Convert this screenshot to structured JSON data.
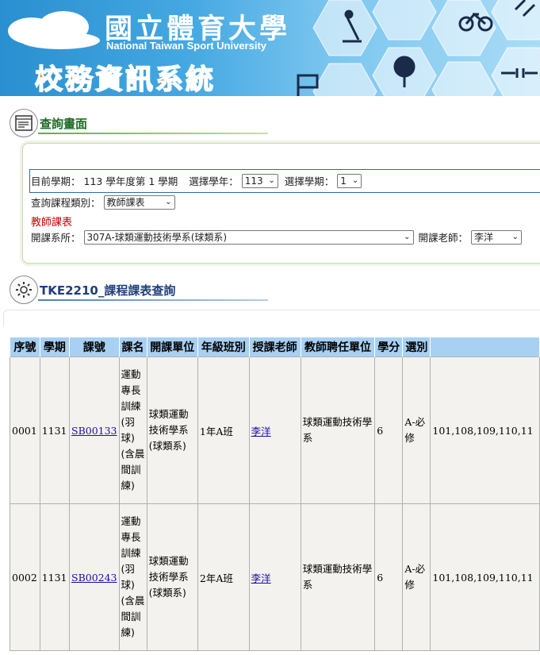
{
  "banner": {
    "title_cn": "國立體育大學",
    "title_en": "National Taiwan Sport University",
    "subtitle": "校務資訊系統"
  },
  "query_section": {
    "title": "查詢畫面",
    "term_label": "目前學期：",
    "term_value": "113 學年度第 1 學期",
    "year_label": "選擇學年：",
    "year_value": "113",
    "semester_label": "選擇學期：",
    "semester_value": "1",
    "category_label": "查詢課程類別：",
    "category_value": "教師課表",
    "heading": "教師課表",
    "dept_label": "開課系所：",
    "dept_value": "307A-球類運動技術學系(球類系)",
    "teacher_label": "開課老師：",
    "teacher_value": "李洋"
  },
  "result_section": {
    "title": "TKE2210_課程課表查詢"
  },
  "table": {
    "headers": [
      "序號",
      "學期",
      "課號",
      "課名",
      "開課單位",
      "年級班別",
      "授課老師",
      "教師聘任單位",
      "學分",
      "選別",
      ""
    ],
    "rows": [
      {
        "seq": "0001",
        "term": "1131",
        "code": "SB00133",
        "name": "運動專長訓練(羽球)(含晨間訓練)",
        "unit": "球類運動技術學系(球類系)",
        "class": "1年A班",
        "teacher": "李洋",
        "employ_unit": "球類運動技術學系",
        "credit": "6",
        "type": "A-必修",
        "periods": "101,108,109,110,11"
      },
      {
        "seq": "0002",
        "term": "1131",
        "code": "SB00243",
        "name": "運動專長訓練(羽球)(含晨間訓練)",
        "unit": "球類運動技術學系(球類系)",
        "class": "2年A班",
        "teacher": "李洋",
        "employ_unit": "球類運動技術學系",
        "credit": "6",
        "type": "A-必修",
        "periods": "101,108,109,110,11"
      }
    ]
  },
  "colors": {
    "banner_blue": "#2a8fd0",
    "section_green": "#1f6b25",
    "section_navy": "#1e3f7a",
    "alert_red": "#cc0000",
    "table_header": "#a8d0f2",
    "link": "#1a0dab"
  }
}
